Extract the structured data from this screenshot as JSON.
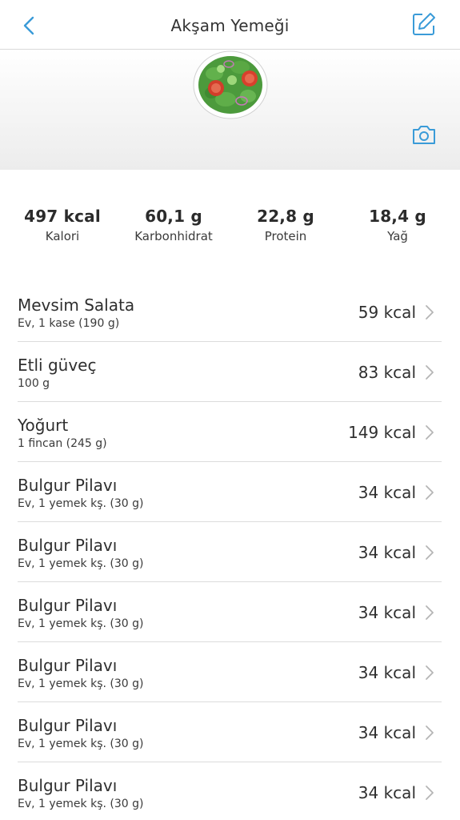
{
  "header": {
    "title": "Akşam Yemeği"
  },
  "icons": {
    "back": "chevron-left-icon",
    "edit": "edit-pencil-icon",
    "camera": "camera-icon",
    "row_arrow": "chevron-right-icon"
  },
  "colors": {
    "accent": "#3a9bd8",
    "divider": "#dcdcdc"
  },
  "macros": [
    {
      "value": "497 kcal",
      "label": "Kalori"
    },
    {
      "value": "60,1 g",
      "label": "Karbonhidrat"
    },
    {
      "value": "22,8 g",
      "label": "Protein"
    },
    {
      "value": "18,4 g",
      "label": "Yağ"
    }
  ],
  "foods": [
    {
      "name": "Mevsim Salata",
      "portion": "Ev, 1 kase (190 g)",
      "kcal": "59 kcal"
    },
    {
      "name": "Etli güveç",
      "portion": "100 g",
      "kcal": "83 kcal"
    },
    {
      "name": "Yoğurt",
      "portion": "1 fincan (245 g)",
      "kcal": "149 kcal"
    },
    {
      "name": "Bulgur Pilavı",
      "portion": "Ev, 1 yemek kş. (30 g)",
      "kcal": "34 kcal"
    },
    {
      "name": "Bulgur Pilavı",
      "portion": "Ev, 1 yemek kş. (30 g)",
      "kcal": "34 kcal"
    },
    {
      "name": "Bulgur Pilavı",
      "portion": "Ev, 1 yemek kş. (30 g)",
      "kcal": "34 kcal"
    },
    {
      "name": "Bulgur Pilavı",
      "portion": "Ev, 1 yemek kş. (30 g)",
      "kcal": "34 kcal"
    },
    {
      "name": "Bulgur Pilavı",
      "portion": "Ev, 1 yemek kş. (30 g)",
      "kcal": "34 kcal"
    },
    {
      "name": "Bulgur Pilavı",
      "portion": "Ev, 1 yemek kş. (30 g)",
      "kcal": "34 kcal"
    }
  ]
}
